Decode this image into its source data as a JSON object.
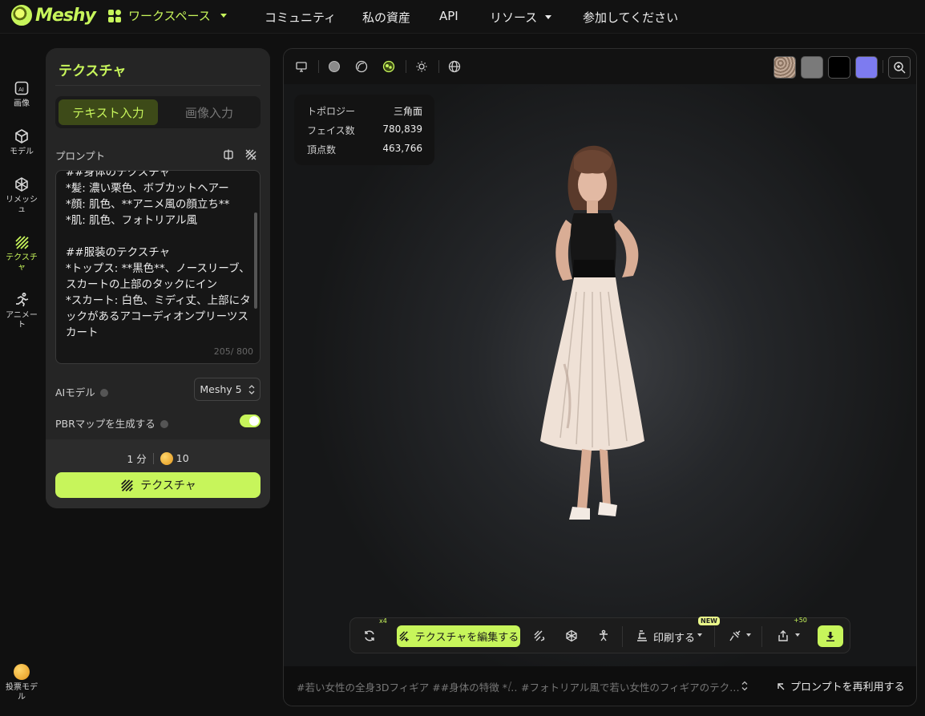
{
  "nav": {
    "logo": "Meshy",
    "workspace": "ワークスペース",
    "items": [
      "コミュニティ",
      "私の資産",
      "API",
      "リソース",
      "参加してください"
    ]
  },
  "rail": {
    "items": [
      {
        "label": "画像",
        "icon": "image-ai-icon"
      },
      {
        "label": "モデル",
        "icon": "cube-icon"
      },
      {
        "label": "リメッシュ",
        "icon": "remesh-icon"
      },
      {
        "label": "テクスチャ",
        "icon": "texture-icon",
        "active": true
      },
      {
        "label": "アニメート",
        "icon": "running-figure-icon"
      }
    ],
    "vote": "投票モデル"
  },
  "panel": {
    "title": "テクスチャ",
    "tab_text": "テキスト入力",
    "tab_image": "画像入力",
    "prompt_label": "プロンプト",
    "prompt_text": "##身体のテクスチャ\n*髪: 濃い栗色、ボブカットヘアー\n*顔: 肌色、**アニメ風の顔立ち**\n*肌: 肌色、フォトリアル風\n\n##服装のテクスチャ\n*トップス: **黒色**、ノースリーブ、スカートの上部のタックにイン\n*スカート: 白色、ミディ丈、上部にタックがあるアコーディオンプリーツスカート",
    "prompt_count": "205/ 800",
    "ai_model_label": "AIモデル",
    "ai_model_value": "Meshy 5",
    "pbr_label": "PBRマップを生成する",
    "pbr_on": true,
    "time": "1 分",
    "credits": "10",
    "submit": "テクスチャ"
  },
  "viewer": {
    "swatch_colors": [
      "#b9a08f",
      "#7a7a7a",
      "#000000",
      "#7d7bf0"
    ],
    "stats": [
      {
        "label": "トポロジー",
        "value": "三角面"
      },
      {
        "label": "フェイス数",
        "value": "780,839"
      },
      {
        "label": "頂点数",
        "value": "463,766"
      }
    ],
    "toolbar": {
      "x4": "x4",
      "edit_texture": "テクスチャを編集する",
      "print": "印刷する",
      "new_badge": "NEW",
      "plus50": "+50"
    },
    "history": [
      "#若い女性の全身3Dフィギア ##身体の特徴 *…",
      "#フォトリアル風で若い女性のフィギアのテク…"
    ],
    "history_sep": "/",
    "reuse": "プロンプトを再利用する"
  },
  "colors": {
    "accent": "#c7f55b",
    "bg": "#101010",
    "panel": "#252525"
  }
}
